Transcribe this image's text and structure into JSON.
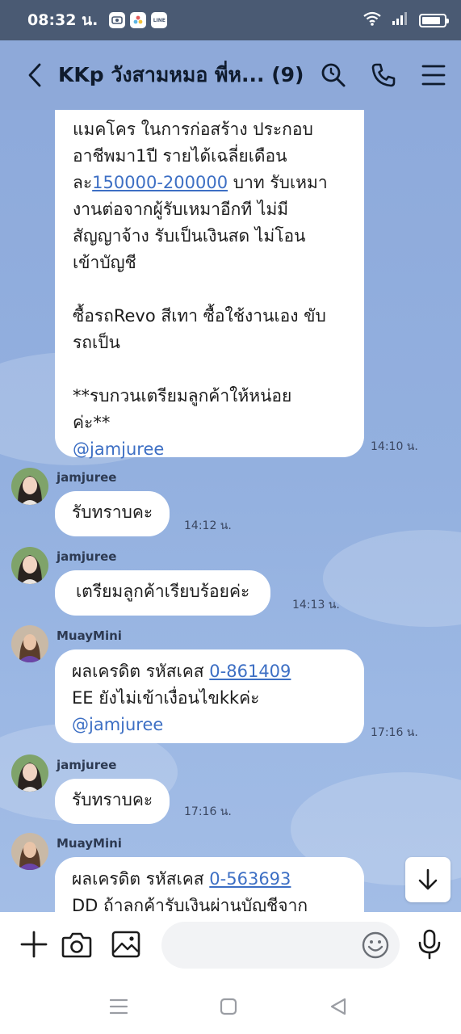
{
  "status_bar": {
    "time": "08:32 น.",
    "app_icons": [
      "messenger-app-icon",
      "photos-app-icon",
      "line-app-icon"
    ],
    "line_label": "LINE"
  },
  "header": {
    "title": "KKp วังสามหมอ พี่ห... (9)",
    "icons": [
      "back-icon",
      "search-icon",
      "phone-icon",
      "menu-icon"
    ]
  },
  "messages": [
    {
      "sender": "",
      "text_before": "แมคโคร ในการก่อสร้าง ประกอบ\nอาชีพมา1ปี รายได้เฉลี่ยเดือน\nละ",
      "link": "150000-200000",
      "text_after": " บาท รับเหมา\nงานต่อจากผู้รับเหมาอีกที ไม่มี\nสัญญาจ้าง รับเป็นเงินสด ไม่โอน\nเข้าบัญชี\n\nซื้อรถRevo สีเทา ซื้อใช้งานเอง ขับ\nรถเป็น\n\n**รบกวนเตรียมลูกค้าให้หน่อย\nค่ะ**",
      "mention": "@jamjuree",
      "time": "14:10 น."
    },
    {
      "sender": "jamjuree",
      "text": "รับทราบคะ",
      "time": "14:12 น."
    },
    {
      "sender": "jamjuree",
      "text": "เตรียมลูกค้าเรียบร้อยค่ะ",
      "time": "14:13 น."
    },
    {
      "sender": "MuayMini",
      "text_before": "ผลเครดิต รหัสเคส ",
      "link": "0-861409",
      "text_after": "\nEE ยังไม่เข้าเงื่อนไขkkค่ะ",
      "mention": "@jamjuree",
      "time": "17:16 น."
    },
    {
      "sender": "jamjuree",
      "text": "รับทราบคะ",
      "time": "17:16 น."
    },
    {
      "sender": "MuayMini",
      "text_before": "ผลเครดิต รหัสเคส ",
      "link": "0-563693",
      "text_after": "\nDD ถ้าลูกค้ารับเงินผ่านบัญชีจาก",
      "time": ""
    }
  ],
  "input": {
    "placeholder": "",
    "icons": [
      "add-icon",
      "camera-icon",
      "image-icon",
      "emoji-icon",
      "microphone-icon"
    ]
  },
  "colors": {
    "chat_bg": "#93b0df",
    "header_bg": "#8ea9d9",
    "status_bg": "#4a5a73",
    "link": "#3d6fc4"
  }
}
